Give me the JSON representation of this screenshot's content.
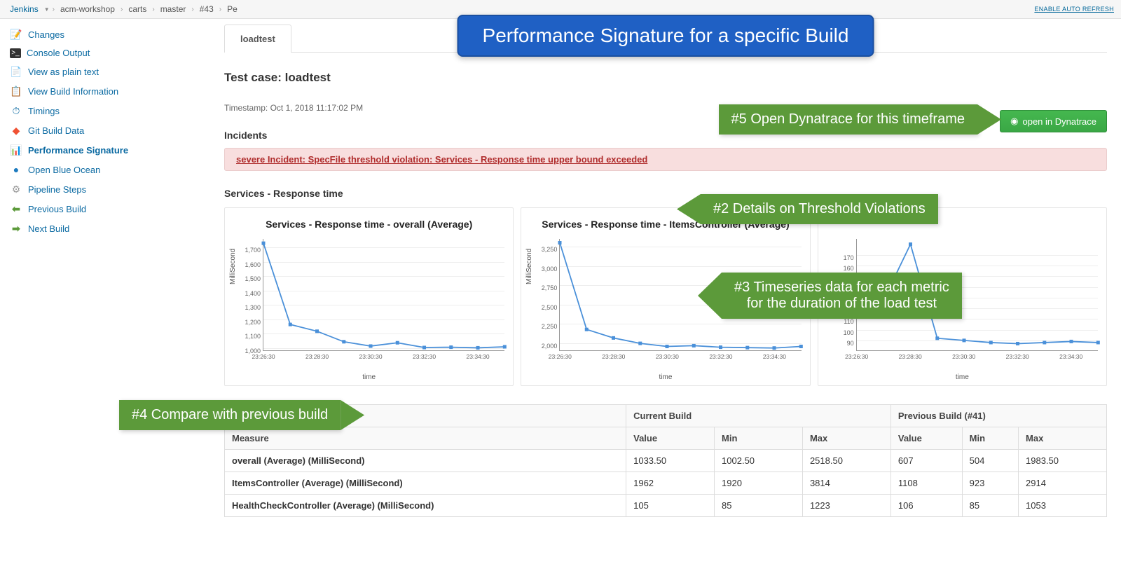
{
  "breadcrumb": {
    "items": [
      "Jenkins",
      "acm-workshop",
      "carts",
      "master",
      "#43",
      "Pe"
    ],
    "auto_refresh": "ENABLE AUTO REFRESH"
  },
  "sidebar": {
    "items": [
      {
        "label": "Changes",
        "icon": "📝"
      },
      {
        "label": "Console Output",
        "icon": "🖥"
      },
      {
        "label": "View as plain text",
        "icon": "📄"
      },
      {
        "label": "View Build Information",
        "icon": "📋"
      },
      {
        "label": "Timings",
        "icon": "⏱"
      },
      {
        "label": "Git Build Data",
        "icon": "◆"
      },
      {
        "label": "Performance Signature",
        "icon": "📊",
        "active": true
      },
      {
        "label": "Open Blue Ocean",
        "icon": "🔵"
      },
      {
        "label": "Pipeline Steps",
        "icon": "⚙"
      },
      {
        "label": "Previous Build",
        "icon": "←"
      },
      {
        "label": "Next Build",
        "icon": "→"
      }
    ]
  },
  "main": {
    "tab_label": "loadtest",
    "testcase_label": "Test case: loadtest",
    "timestamp": "Timestamp: Oct 1, 2018 11:17:02 PM",
    "incidents_heading": "Incidents",
    "incident_text": "severe Incident: SpecFile threshold violation: Services - Response time upper bound exceeded",
    "open_dynatrace": "open in Dynatrace",
    "metric_heading": "Services - Response time"
  },
  "annotations": {
    "banner": "Performance Signature for a specific Build",
    "a2": "#2 Details on Threshold Violations",
    "a3": "#3 Timeseries data for each metric\nfor the duration of the load test",
    "a4": "#4 Compare with previous build",
    "a5": "#5 Open Dynatrace for this timeframe"
  },
  "table": {
    "group_current": "Current Build",
    "group_previous": "Previous Build (#41)",
    "col_measure": "Measure",
    "col_value": "Value",
    "col_min": "Min",
    "col_max": "Max",
    "rows": [
      {
        "measure": "overall (Average) (MilliSecond)",
        "cv": "1033.50",
        "cmin": "1002.50",
        "cmax": "2518.50",
        "pv": "607",
        "pmin": "504",
        "pmax": "1983.50"
      },
      {
        "measure": "ItemsController (Average) (MilliSecond)",
        "cv": "1962",
        "cmin": "1920",
        "cmax": "3814",
        "pv": "1108",
        "pmin": "923",
        "pmax": "2914"
      },
      {
        "measure": "HealthCheckController (Average) (MilliSecond)",
        "cv": "105",
        "cmin": "85",
        "cmax": "1223",
        "pv": "106",
        "pmin": "85",
        "pmax": "1053"
      }
    ]
  },
  "chart_data": [
    {
      "type": "line",
      "title": "Services - Response time - overall (Average)",
      "ylabel": "MilliSecond",
      "xlabel": "time",
      "categories": [
        "23:26:30",
        "23:28:30",
        "23:30:30",
        "23:32:30",
        "23:34:30"
      ],
      "raw_x": [
        0,
        1,
        2,
        3,
        4,
        5,
        6,
        7,
        8,
        9
      ],
      "values": [
        1730,
        1165,
        1118,
        1045,
        1015,
        1038,
        1005,
        1007,
        1003,
        1010
      ],
      "yticks": [
        1000,
        1100,
        1200,
        1300,
        1400,
        1500,
        1600,
        1700
      ],
      "ylim": [
        980,
        1760
      ]
    },
    {
      "type": "line",
      "title": "Services - Response time - ItemsController (Average)",
      "ylabel": "MilliSecond",
      "xlabel": "time",
      "categories": [
        "23:26:30",
        "23:28:30",
        "23:30:30",
        "23:32:30",
        "23:34:30"
      ],
      "raw_x": [
        0,
        1,
        2,
        3,
        4,
        5,
        6,
        7,
        8,
        9
      ],
      "values": [
        3300,
        2180,
        2070,
        2000,
        1960,
        1970,
        1950,
        1945,
        1940,
        1960
      ],
      "yticks": [
        2000,
        2250,
        2500,
        2750,
        3000,
        3250
      ],
      "ylim": [
        1900,
        3350
      ]
    },
    {
      "type": "line",
      "title": "",
      "ylabel": "",
      "xlabel": "time",
      "categories": [
        "23:26:30",
        "23:28:30",
        "23:30:30",
        "23:32:30",
        "23:34:30"
      ],
      "raw_x": [
        0,
        1,
        2,
        3,
        4,
        5,
        6,
        7,
        8,
        9
      ],
      "values": [
        115,
        128,
        180,
        92,
        90,
        88,
        87,
        88,
        89,
        88
      ],
      "yticks": [
        90,
        100,
        110,
        120,
        130,
        140,
        150,
        160,
        170
      ],
      "ylim": [
        80,
        185
      ]
    }
  ]
}
